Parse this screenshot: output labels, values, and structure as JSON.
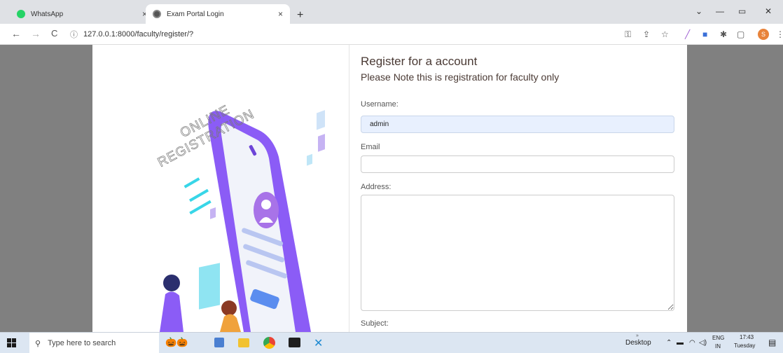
{
  "tabs": [
    {
      "title": "WhatsApp",
      "close": "×"
    },
    {
      "title": "Exam Portal Login",
      "close": "×"
    }
  ],
  "new_tab": "+",
  "window_controls": {
    "minimize": "—",
    "restore": "▭",
    "close": "✕",
    "tabsearch": "⌄"
  },
  "address": {
    "url": "127.0.0.1:8000/faculty/register/?",
    "info_icon": "ⓘ"
  },
  "nav": {
    "back": "←",
    "forward": "→",
    "reload": "C"
  },
  "toolbar_icons": [
    "key-icon",
    "share-icon",
    "star-icon",
    "pen-icon",
    "extension-icon",
    "puzzle-icon",
    "sidepanel-icon"
  ],
  "profile_initial": "S",
  "illustration": {
    "line1": "ONLINE",
    "line2": "REGISTRATION"
  },
  "form": {
    "title": "Register for a account",
    "subtitle": "Please Note this is registration for faculty only",
    "username_label": "Username:",
    "username_value": "admin",
    "email_label": "Email",
    "email_value": "",
    "address_label": "Address:",
    "subject_label": "Subject:"
  },
  "taskbar": {
    "search_placeholder": "Type here to search",
    "desktop": "Desktop",
    "lang1": "ENG",
    "lang2": "IN",
    "time": "17:43",
    "day": "Tuesday",
    "chevron": "»"
  },
  "colors": {
    "accent_purple": "#8b5cf6",
    "cyan": "#38d6e8",
    "username_fill": "#e8f0fe"
  }
}
